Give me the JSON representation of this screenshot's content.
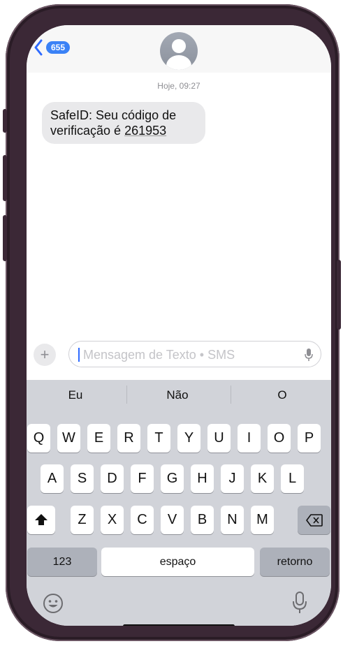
{
  "header": {
    "back_badge": "655"
  },
  "conversation": {
    "timestamp": "Hoje, 09:27",
    "message_prefix": "SafeID: Seu código de verificação é ",
    "message_code": "261953"
  },
  "input": {
    "placeholder": "Mensagem de Texto • SMS",
    "plus_label": "+"
  },
  "keyboard": {
    "suggestions": [
      "Eu",
      "Não",
      "O"
    ],
    "row1": [
      "Q",
      "W",
      "E",
      "R",
      "T",
      "Y",
      "U",
      "I",
      "O",
      "P"
    ],
    "row2": [
      "A",
      "S",
      "D",
      "F",
      "G",
      "H",
      "J",
      "K",
      "L"
    ],
    "row3": [
      "Z",
      "X",
      "C",
      "V",
      "B",
      "N",
      "M"
    ],
    "numbers_key": "123",
    "space_key": "espaço",
    "return_key": "retorno"
  },
  "colors": {
    "accent": "#3b82f6",
    "bubble": "#e9e9eb",
    "keyboard_bg": "#d1d3d9"
  }
}
